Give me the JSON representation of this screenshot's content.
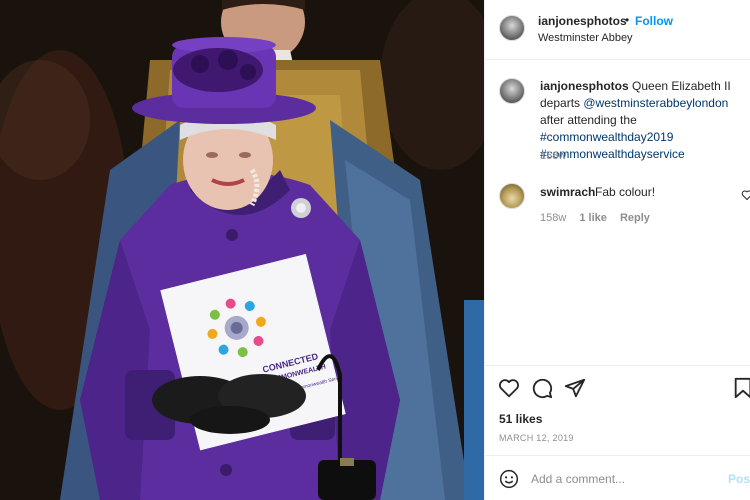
{
  "photo": {
    "program_text": [
      "CONNECTED",
      "COMMONWEALTH"
    ],
    "program_subtext": "Commonwealth Service",
    "colors": {
      "coat": "#5b2d9e",
      "hat": "#6a35b5",
      "gloves": "#1b1b1b",
      "vestment": "#b08a3a",
      "robe_blue": "#3f5f87"
    }
  },
  "header": {
    "username": "ianjonesphotos",
    "separator": "•",
    "follow_label": "Follow",
    "location": "Westminster Abbey"
  },
  "caption": {
    "username": "ianjonesphotos",
    "text": "Queen Elizabeth II departs",
    "mention": "@westminsterabbeylondon",
    "text2": "after attending the",
    "hashtag1": "#commonwealthday2019",
    "hashtag2": "#commonwealthdayservice",
    "time": "158w"
  },
  "comment": {
    "username": "swimrach",
    "text": "Fab colour!",
    "time": "158w",
    "likes": "1 like",
    "reply_label": "Reply"
  },
  "actions": {
    "likes": "51 likes",
    "date": "MARCH 12, 2019"
  },
  "add_comment": {
    "placeholder": "Add a comment...",
    "post_label": "Post"
  },
  "colors": {
    "link": "#0095f6",
    "mention": "#00376b",
    "post_disabled": "#b2dffc",
    "muted": "#8e8e8e"
  }
}
